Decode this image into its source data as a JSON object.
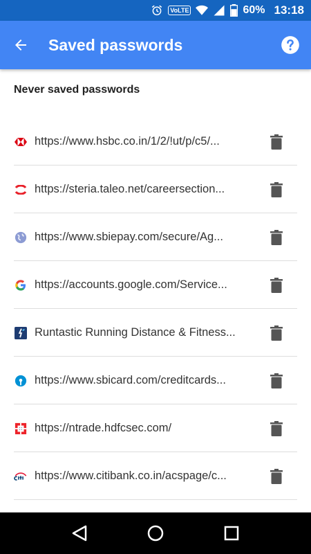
{
  "status_bar": {
    "volte": "VoLTE",
    "battery": "60%",
    "time": "13:18"
  },
  "app_bar": {
    "title": "Saved passwords"
  },
  "section": {
    "header": "Never saved passwords"
  },
  "items": [
    {
      "text": "https://www.hsbc.co.in/1/2/!ut/p/c5/...",
      "icon": "hsbc-favicon-icon"
    },
    {
      "text": "https://steria.taleo.net/careersection...",
      "icon": "steria-favicon-icon"
    },
    {
      "text": "https://www.sbiepay.com/secure/Ag...",
      "icon": "globe-icon"
    },
    {
      "text": "https://accounts.google.com/Service...",
      "icon": "google-favicon-icon"
    },
    {
      "text": "Runtastic Running Distance & Fitness...",
      "icon": "runtastic-icon"
    },
    {
      "text": "https://www.sbicard.com/creditcards...",
      "icon": "sbicard-favicon-icon"
    },
    {
      "text": "https://ntrade.hdfcsec.com/",
      "icon": "hdfc-favicon-icon"
    },
    {
      "text": "https://www.citibank.co.in/acspage/c...",
      "icon": "citi-favicon-icon"
    }
  ],
  "colors": {
    "status_bar": "#1565c0",
    "app_bar": "#4285f4",
    "divider": "#dddddd",
    "nav_bar": "#000000"
  }
}
